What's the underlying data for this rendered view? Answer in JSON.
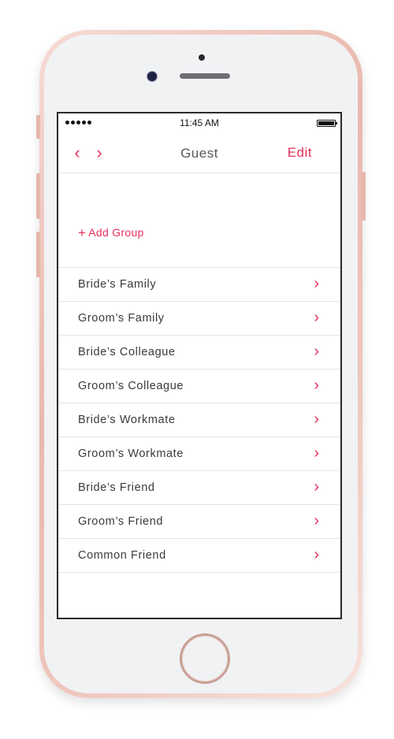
{
  "status_bar": {
    "time": "11:45 AM"
  },
  "navbar": {
    "back_icon": "chevron-left-icon",
    "back_glyph": "‹",
    "forward_icon": "chevron-right-icon",
    "forward_glyph": "›",
    "title": "Guest",
    "edit_label": "Edit"
  },
  "add_group": {
    "plus_glyph": "+",
    "label": "Add Group"
  },
  "groups": [
    {
      "label": "Bride’s Family"
    },
    {
      "label": "Groom’s Family"
    },
    {
      "label": "Bride’s Colleague"
    },
    {
      "label": "Groom’s Colleague"
    },
    {
      "label": "Bride’s Workmate"
    },
    {
      "label": "Groom’s Workmate"
    },
    {
      "label": "Bride’s Friend"
    },
    {
      "label": "Groom’s Friend"
    },
    {
      "label": "Common Friend"
    }
  ],
  "chevron_glyph": "›",
  "colors": {
    "accent": "#e8305d",
    "text": "#3a3a3a",
    "title": "#55595c",
    "divider": "#e4e4e4"
  }
}
